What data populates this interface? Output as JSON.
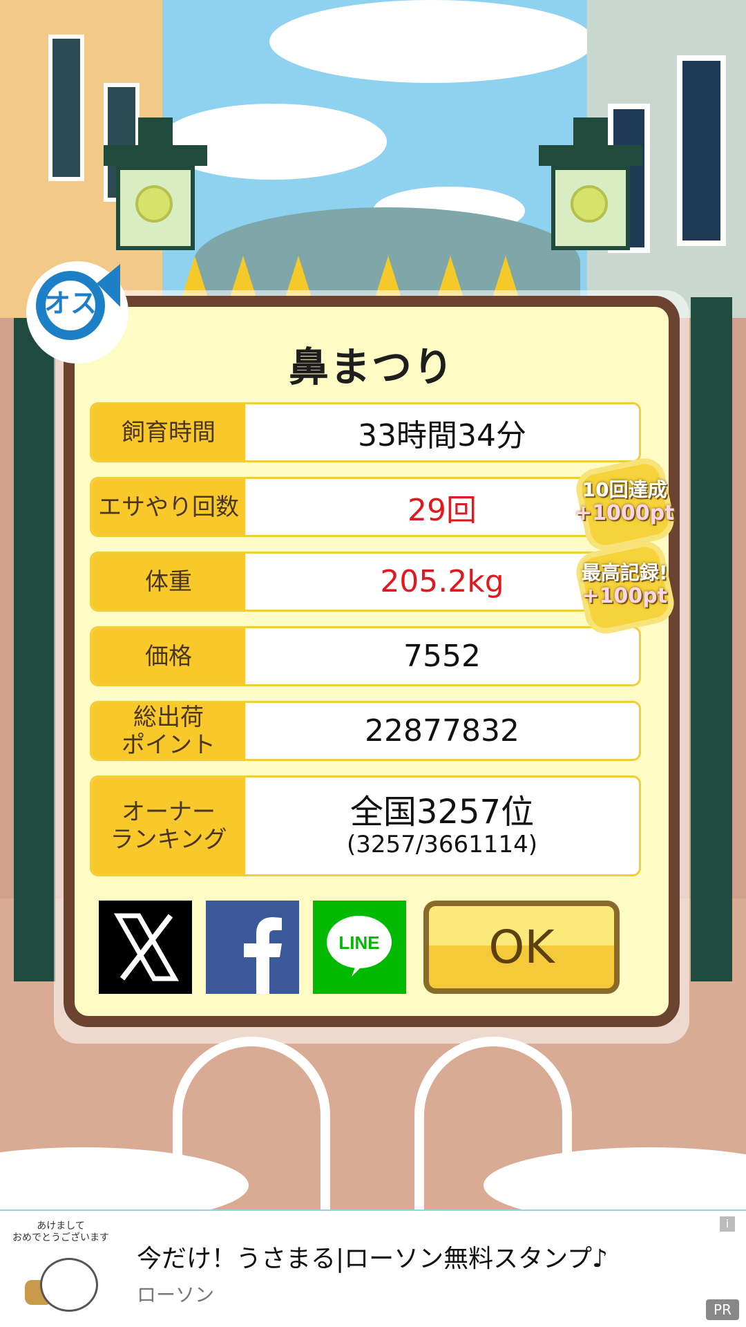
{
  "dialog": {
    "title": "鼻まつり",
    "rows": [
      {
        "label": "飼育時間",
        "value": "33時間34分"
      },
      {
        "label": "エサやり回数",
        "value": "29回"
      },
      {
        "label": "体重",
        "value": "205.2kg"
      },
      {
        "label": "価格",
        "value": "7552"
      },
      {
        "label": "総出荷\nポイント",
        "value": "22877832"
      },
      {
        "label": "オーナー\nランキング",
        "value": "全国3257位",
        "value2": "(3257/3661114)"
      }
    ],
    "gender_label": "オス",
    "badges": [
      {
        "line1": "10回達成",
        "line2": "+1000pt"
      },
      {
        "line1": "最高記録!",
        "line2": "+100pt"
      }
    ],
    "share": {
      "x_label": "X",
      "facebook_label": "f",
      "line_label": "LINE"
    },
    "ok_label": "OK"
  },
  "ad": {
    "image_caption": "あけまして\nおめでとうございます",
    "title": "今だけ！うさまる|ローソン無料スタンプ♪",
    "advertiser": "ローソン",
    "info_icon": "i",
    "pr_label": "PR"
  },
  "colors": {
    "label_bg": "#f9c92c",
    "highlight_value": "#e01920",
    "frame": "#6b4330",
    "panel": "#fffbc5"
  }
}
